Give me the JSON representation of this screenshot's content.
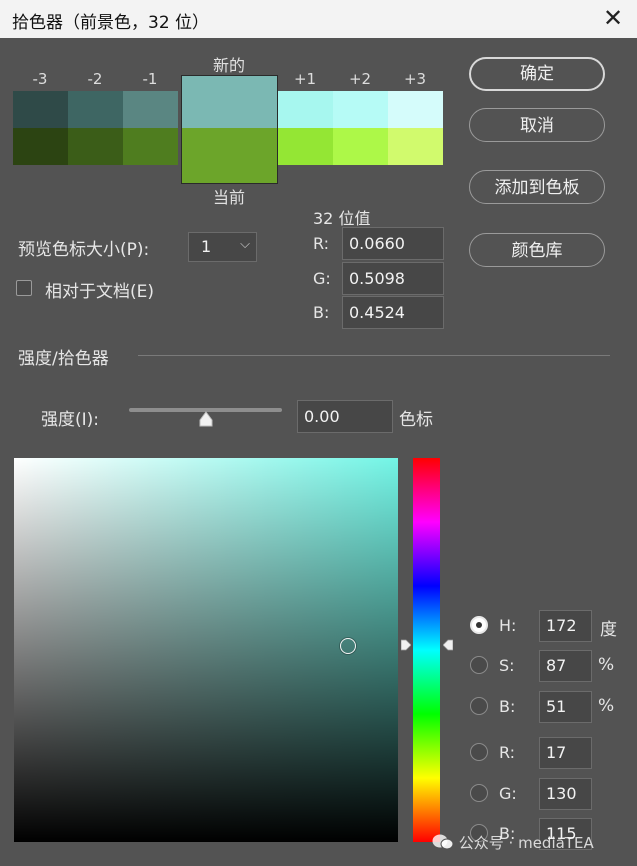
{
  "window": {
    "title": "拾色器（前景色，32 位）",
    "close_glyph": "✕"
  },
  "swatches": {
    "labels": [
      "-3",
      "-2",
      "-1",
      "+1",
      "+2",
      "+3"
    ],
    "new_label": "新的",
    "current_label": "当前",
    "new_colors": [
      "#2f4a48",
      "#3e6663",
      "#5a8682",
      "#7bb8b3",
      "#a7f7ef",
      "#b6fbf6",
      "#d5fcfb"
    ],
    "current_colors": [
      "#2c4412",
      "#3b5d18",
      "#4f7d1f",
      "#6ca52a",
      "#94e634",
      "#adf848",
      "#d1fa6d"
    ]
  },
  "buttons": {
    "ok": "确定",
    "cancel": "取消",
    "add_to_swatches": "添加到色板",
    "color_libraries": "颜色库"
  },
  "preview": {
    "label": "预览色标大小(P):",
    "value": "1",
    "chevron": "⌵",
    "relative_label": "相对于文档(E)",
    "relative_checked": false
  },
  "float_values": {
    "heading": "32 位值",
    "r_label": "R:",
    "r_value": "0.0660",
    "g_label": "G:",
    "g_value": "0.5098",
    "b_label": "B:",
    "b_value": "0.4524"
  },
  "intensity": {
    "section_title": "强度/拾色器",
    "label": "强度(I):",
    "value": "0.00",
    "unit": "色标",
    "slider_level": 0.5
  },
  "picker": {
    "hue_color": "#73f5e6",
    "cursor_s": 0.87,
    "cursor_b": 0.51,
    "hue_fraction": 0.478
  },
  "modes": {
    "h_label": "H:",
    "h_value": "172",
    "h_unit": "度",
    "s_label": "S:",
    "s_value": "87",
    "s_unit": "%",
    "b_label": "B:",
    "b_value": "51",
    "b_unit": "%",
    "r_label": "R:",
    "r_value": "17",
    "g_label": "G:",
    "g_value": "130",
    "b2_label": "B:",
    "b2_value": "115"
  },
  "watermark": {
    "text": "公众号 · mediaTEA"
  }
}
